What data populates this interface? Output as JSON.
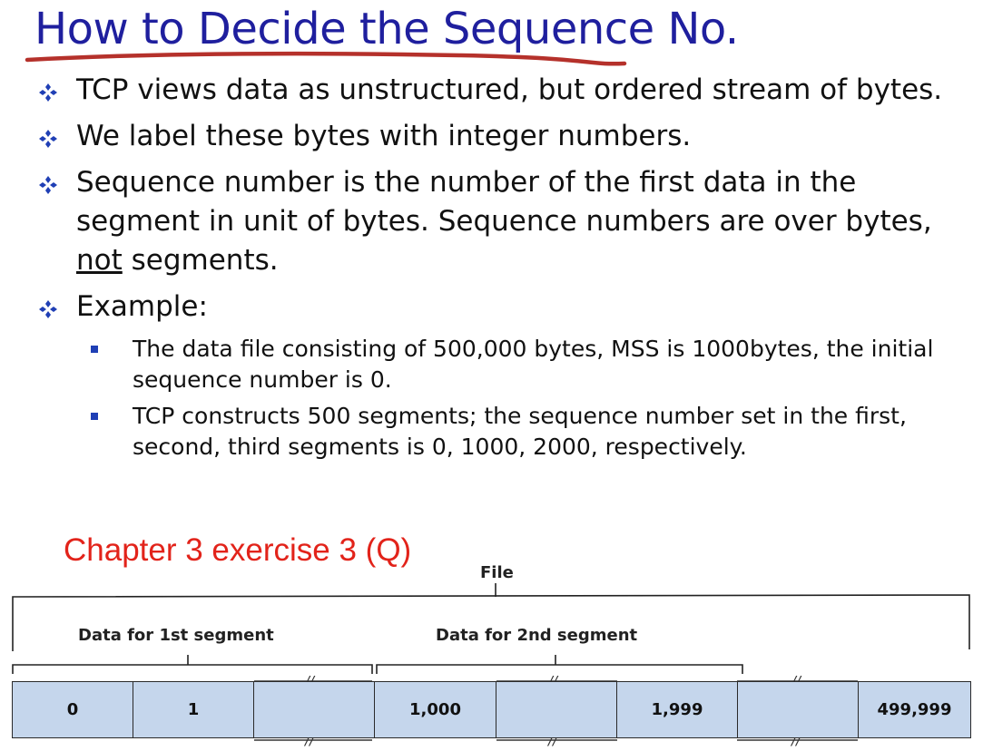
{
  "slide": {
    "title": "How to Decide the Sequence No.",
    "bullets": [
      {
        "text": "TCP views data as unstructured, but ordered stream of bytes."
      },
      {
        "text": "We label these bytes with integer numbers."
      },
      {
        "text_before": "Sequence number is the number of the first data in the segment in unit of bytes. Sequence numbers are over bytes, ",
        "underlined": "not",
        "text_after": " segments."
      },
      {
        "text": "Example:"
      }
    ],
    "sub_bullets": [
      "The data file consisting of 500,000 bytes, MSS is 1000bytes, the initial sequence number is 0.",
      "TCP constructs 500 segments; the sequence number set in the first, second, third segments is 0, 1000, 2000, respectively."
    ],
    "exercise_label": "Chapter 3 exercise 3 (Q)"
  },
  "diagram": {
    "file_label": "File",
    "segment1_label": "Data for 1st segment",
    "segment2_label": "Data for 2nd segment",
    "cells": [
      "0",
      "1",
      "",
      "1,000",
      "",
      "1,999",
      "",
      "499,999"
    ],
    "cell_fill": "#c5d6ec"
  },
  "colors": {
    "title": "#1f1f9e",
    "title_underline": "#b5312b",
    "exercise": "#e2231a",
    "bullet_icon": "#1f3fb5"
  }
}
